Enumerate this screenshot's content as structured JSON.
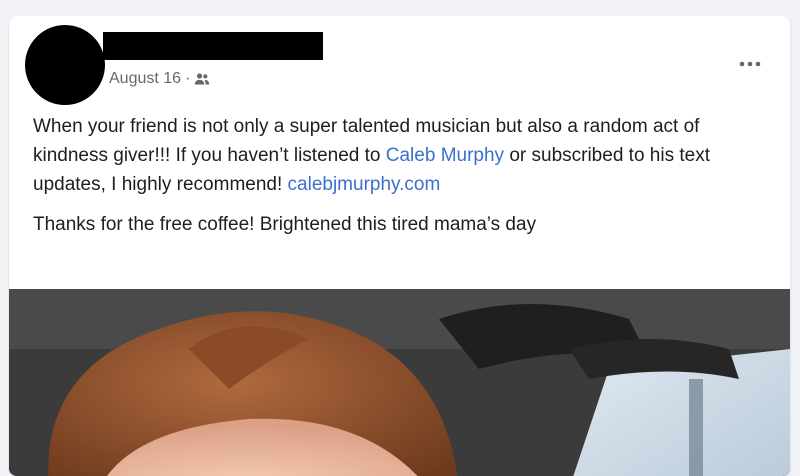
{
  "post": {
    "date": "August 16",
    "separator": "·",
    "audience_icon": "friends-icon",
    "more_icon": "more-options-icon",
    "text": {
      "line1_part1": "When your friend is not only a super talented musician but also a random act of kindness giver!!! If you haven’t listened to ",
      "mention": "Caleb Murphy",
      "line1_part2": " or subscribed to his text updates, I highly recommend! ",
      "url": "calebjmurphy.com",
      "paragraph2": "Thanks for the free coffee! Brightened this tired mama’s day"
    }
  },
  "colors": {
    "link": "#3b6fd0",
    "meta_text": "#65676b",
    "body_text": "#1c1e21"
  }
}
